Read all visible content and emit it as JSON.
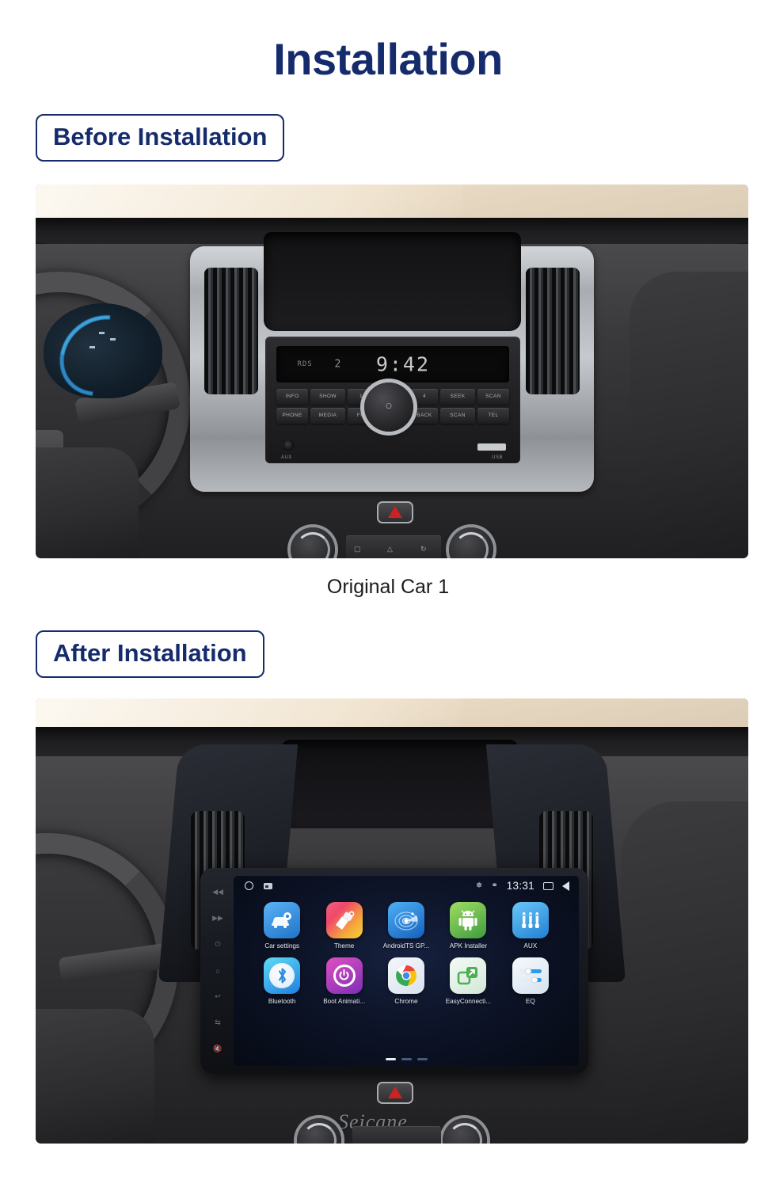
{
  "page": {
    "title": "Installation",
    "title_color": "#152b6b"
  },
  "sections": [
    {
      "label": "Before Installation",
      "caption": "Original Car  1",
      "photo_name": "original-car-dashboard-photo"
    },
    {
      "label": "After Installation",
      "caption": "",
      "photo_name": "installed-android-unit-photo"
    }
  ],
  "factory_radio": {
    "display_time": "9:42",
    "display_source": "RDS",
    "display_preset": "2",
    "buttons_top": [
      "INFO",
      "SHOW",
      "1",
      "4",
      "SEEK",
      "SCAN"
    ],
    "buttons_bottom": [
      "PHONE",
      "MEDIA",
      "FM",
      "BACK",
      "SCAN",
      "TEL"
    ],
    "knob_label": "O",
    "aux_label": "AUX",
    "usb_label": "USB"
  },
  "android_unit": {
    "status_bar": {
      "time": "13:31",
      "bluetooth_icon": "bluetooth-icon",
      "gps_icon": "gps-icon",
      "home_icon": "home-circle-icon",
      "screenshot_icon": "screenshot-icon",
      "recents_icon": "recents-icon",
      "back_icon": "back-icon"
    },
    "apps": [
      {
        "label": "Car settings",
        "icon": "car-settings-icon",
        "color_a": "#4aa6f0",
        "color_b": "#1f73c9"
      },
      {
        "label": "Theme",
        "icon": "theme-brush-icon",
        "color_a": "#f05a7a",
        "color_b": "#f5c13a"
      },
      {
        "label": "AndroidTS GP...",
        "icon": "gps-radar-icon",
        "color_a": "#3fa3f2",
        "color_b": "#1565c0"
      },
      {
        "label": "APK Installer",
        "icon": "android-robot-icon",
        "color_a": "#8ed457",
        "color_b": "#3f9b3f"
      },
      {
        "label": "AUX",
        "icon": "aux-plugs-icon",
        "color_a": "#5fc0f5",
        "color_b": "#2a86d8"
      },
      {
        "label": "Bluetooth",
        "icon": "bluetooth-app-icon",
        "color_a": "#4fd2f5",
        "color_b": "#1f7fe0"
      },
      {
        "label": "Boot Animati...",
        "icon": "power-ring-icon",
        "color_a": "#d93fb0",
        "color_b": "#7b2fb5"
      },
      {
        "label": "Chrome",
        "icon": "chrome-icon",
        "color_a": "#eef2f7",
        "color_b": "#cfd8e4"
      },
      {
        "label": "EasyConnecti...",
        "icon": "easyconnect-icon",
        "color_a": "#eef6ef",
        "color_b": "#cfe6d4"
      },
      {
        "label": "EQ",
        "icon": "equalizer-icon",
        "color_a": "#f2f6fa",
        "color_b": "#d4e0ec"
      }
    ],
    "side_buttons": [
      "volume-down-icon",
      "volume-up-icon",
      "power-icon",
      "home-icon",
      "back-icon",
      "swap-icon",
      "mute-icon"
    ],
    "page_dots": {
      "count": 3,
      "active_index": 0
    }
  },
  "watermark": "Seicane"
}
